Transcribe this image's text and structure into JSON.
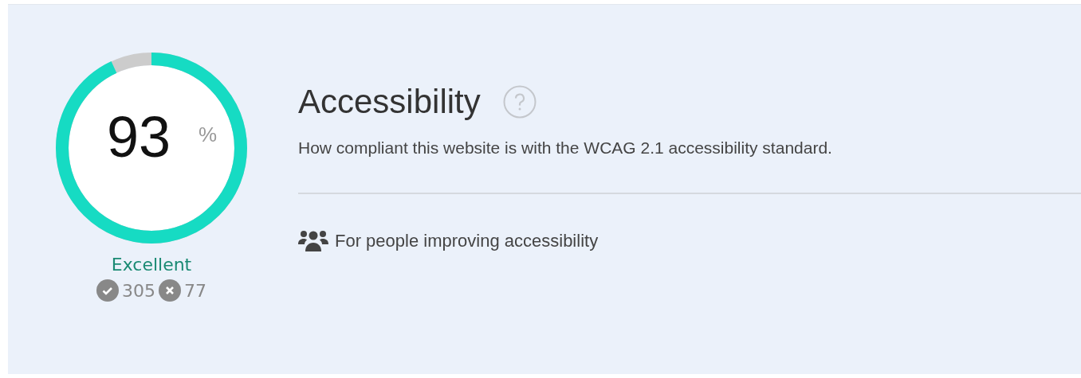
{
  "score": {
    "value": "93",
    "unit": "%",
    "level": 0.93,
    "rating": "Excellent",
    "passed": "305",
    "failed": "77"
  },
  "title": "Accessibility",
  "description": "How compliant this website is with the WCAG 2.1 accessibility standard.",
  "audience": "For people improving accessibility"
}
